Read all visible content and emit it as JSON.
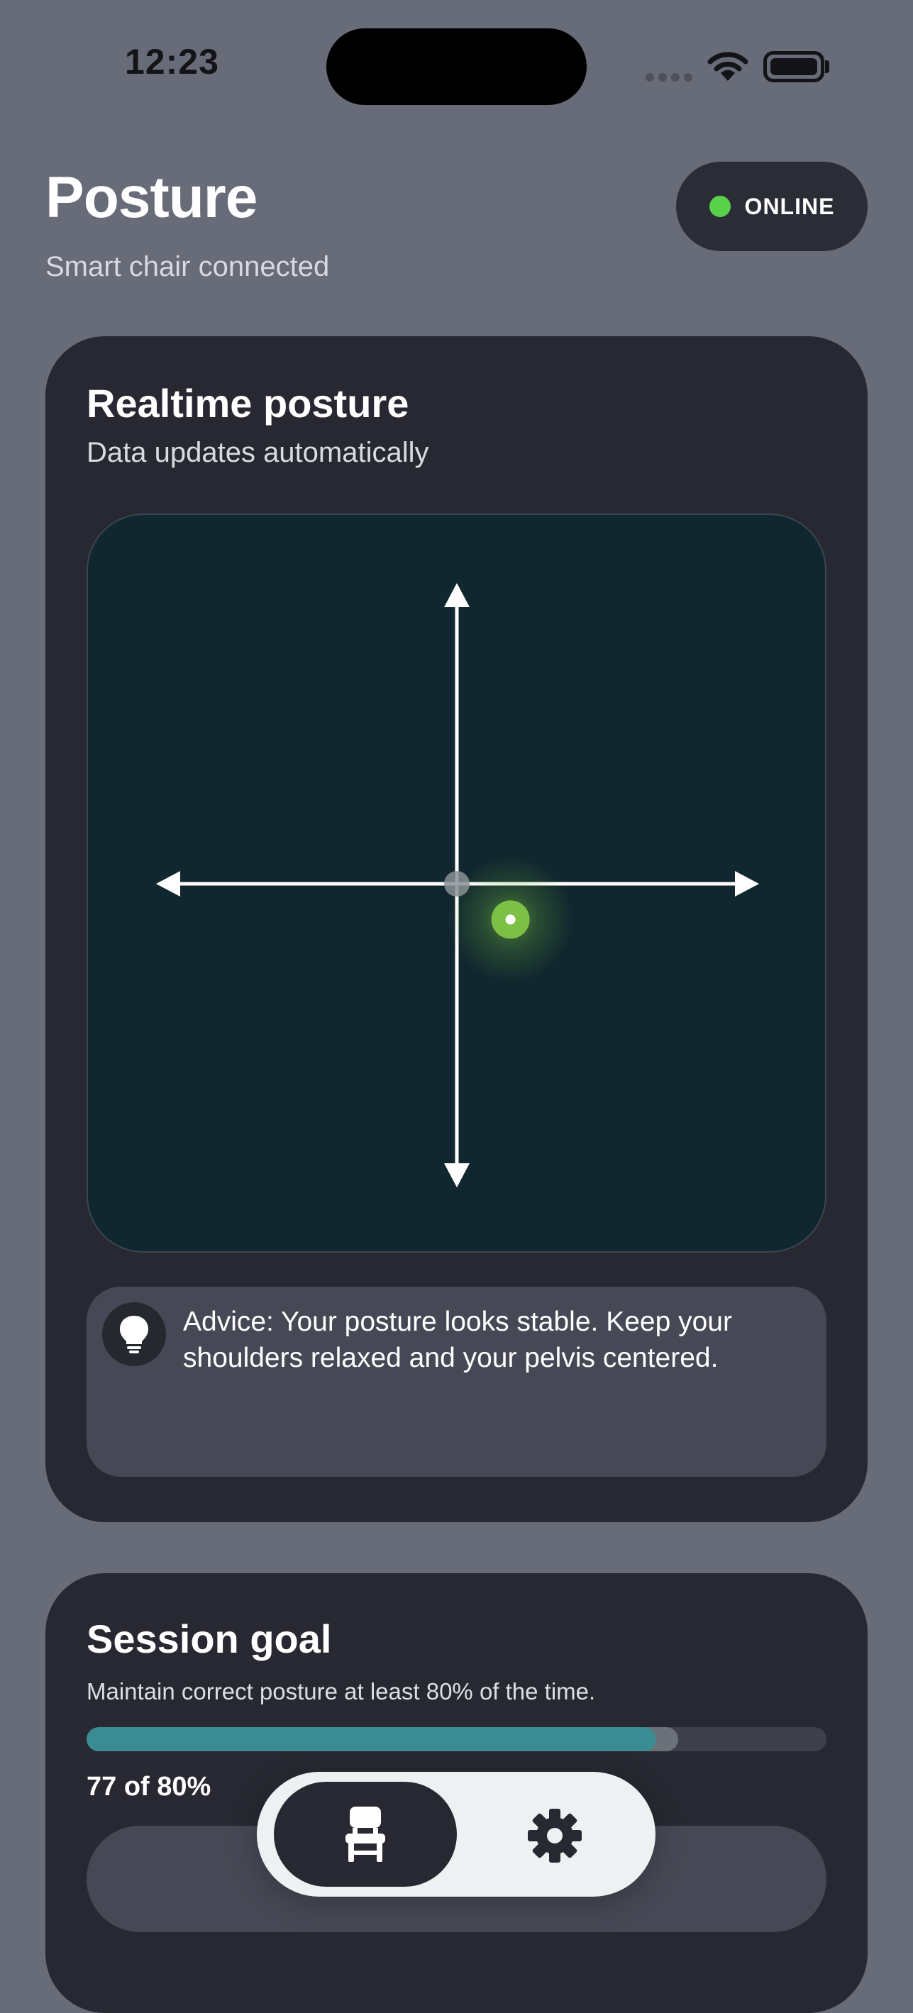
{
  "status_bar": {
    "time": "12:23",
    "icons": [
      "cellular-signal-icon",
      "wifi-icon",
      "battery-icon"
    ]
  },
  "header": {
    "title": "Posture",
    "subtitle": "Smart chair connected",
    "status": {
      "label": "ONLINE",
      "color": "#5ad14a"
    }
  },
  "realtime_card": {
    "title": "Realtime posture",
    "subtitle": "Data updates automatically",
    "posture_point": {
      "x": 0.18,
      "y": -0.12,
      "color": "#7dc046"
    },
    "advice": {
      "icon": "lightbulb-icon",
      "text": "Advice: Your posture looks stable. Keep your shoulders relaxed and your pelvis centered."
    }
  },
  "goal_card": {
    "title": "Session goal",
    "description": "Maintain correct posture at least 80% of the time.",
    "progress_label": "77 of 80%",
    "progress_current": 0.77,
    "progress_target": 0.8,
    "accent": "#3a8c92"
  },
  "tabbar": {
    "tabs": [
      {
        "icon": "chair-icon",
        "active": true
      },
      {
        "icon": "gear-icon",
        "active": false
      }
    ]
  }
}
